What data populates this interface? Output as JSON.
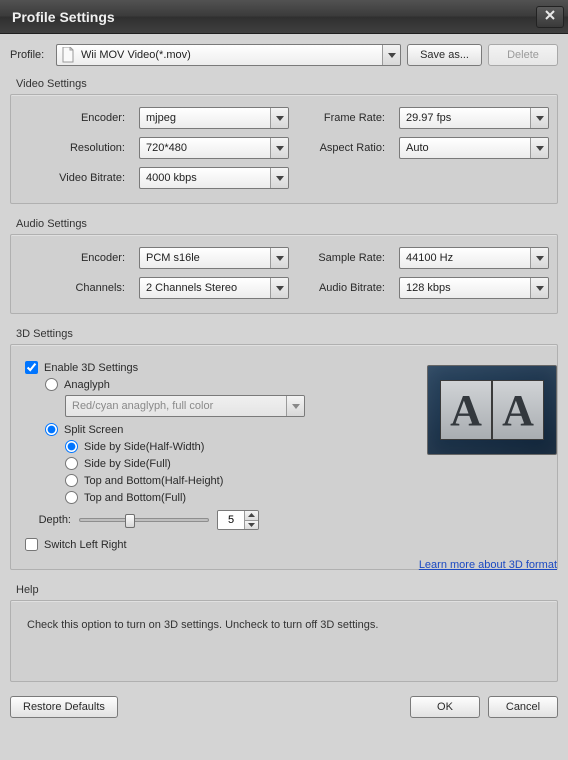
{
  "window": {
    "title": "Profile Settings"
  },
  "profile": {
    "label": "Profile:",
    "value": "Wii MOV Video(*.mov)",
    "save_as_label": "Save as...",
    "delete_label": "Delete"
  },
  "video": {
    "section_title": "Video Settings",
    "encoder_label": "Encoder:",
    "encoder_value": "mjpeg",
    "resolution_label": "Resolution:",
    "resolution_value": "720*480",
    "bitrate_label": "Video Bitrate:",
    "bitrate_value": "4000 kbps",
    "framerate_label": "Frame Rate:",
    "framerate_value": "29.97 fps",
    "aspect_label": "Aspect Ratio:",
    "aspect_value": "Auto"
  },
  "audio": {
    "section_title": "Audio Settings",
    "encoder_label": "Encoder:",
    "encoder_value": "PCM s16le",
    "channels_label": "Channels:",
    "channels_value": "2 Channels Stereo",
    "samplerate_label": "Sample Rate:",
    "samplerate_value": "44100 Hz",
    "bitrate_label": "Audio Bitrate:",
    "bitrate_value": "128 kbps"
  },
  "three_d": {
    "section_title": "3D Settings",
    "enable_label": "Enable 3D Settings",
    "enable_checked": true,
    "mode_anaglyph_label": "Anaglyph",
    "mode_split_label": "Split Screen",
    "mode_selected": "split",
    "anaglyph_option": "Red/cyan anaglyph, full color",
    "split_options": {
      "sbs_half": "Side by Side(Half-Width)",
      "sbs_full": "Side by Side(Full)",
      "tb_half": "Top and Bottom(Half-Height)",
      "tb_full": "Top and Bottom(Full)"
    },
    "split_selected": "sbs_half",
    "depth_label": "Depth:",
    "depth_value": "5",
    "switch_lr_label": "Switch Left Right",
    "switch_lr_checked": false,
    "learn_more_label": "Learn more about 3D format"
  },
  "help": {
    "section_title": "Help",
    "text": "Check this option to turn on 3D settings. Uncheck to turn off 3D settings."
  },
  "footer": {
    "restore_label": "Restore Defaults",
    "ok_label": "OK",
    "cancel_label": "Cancel"
  }
}
